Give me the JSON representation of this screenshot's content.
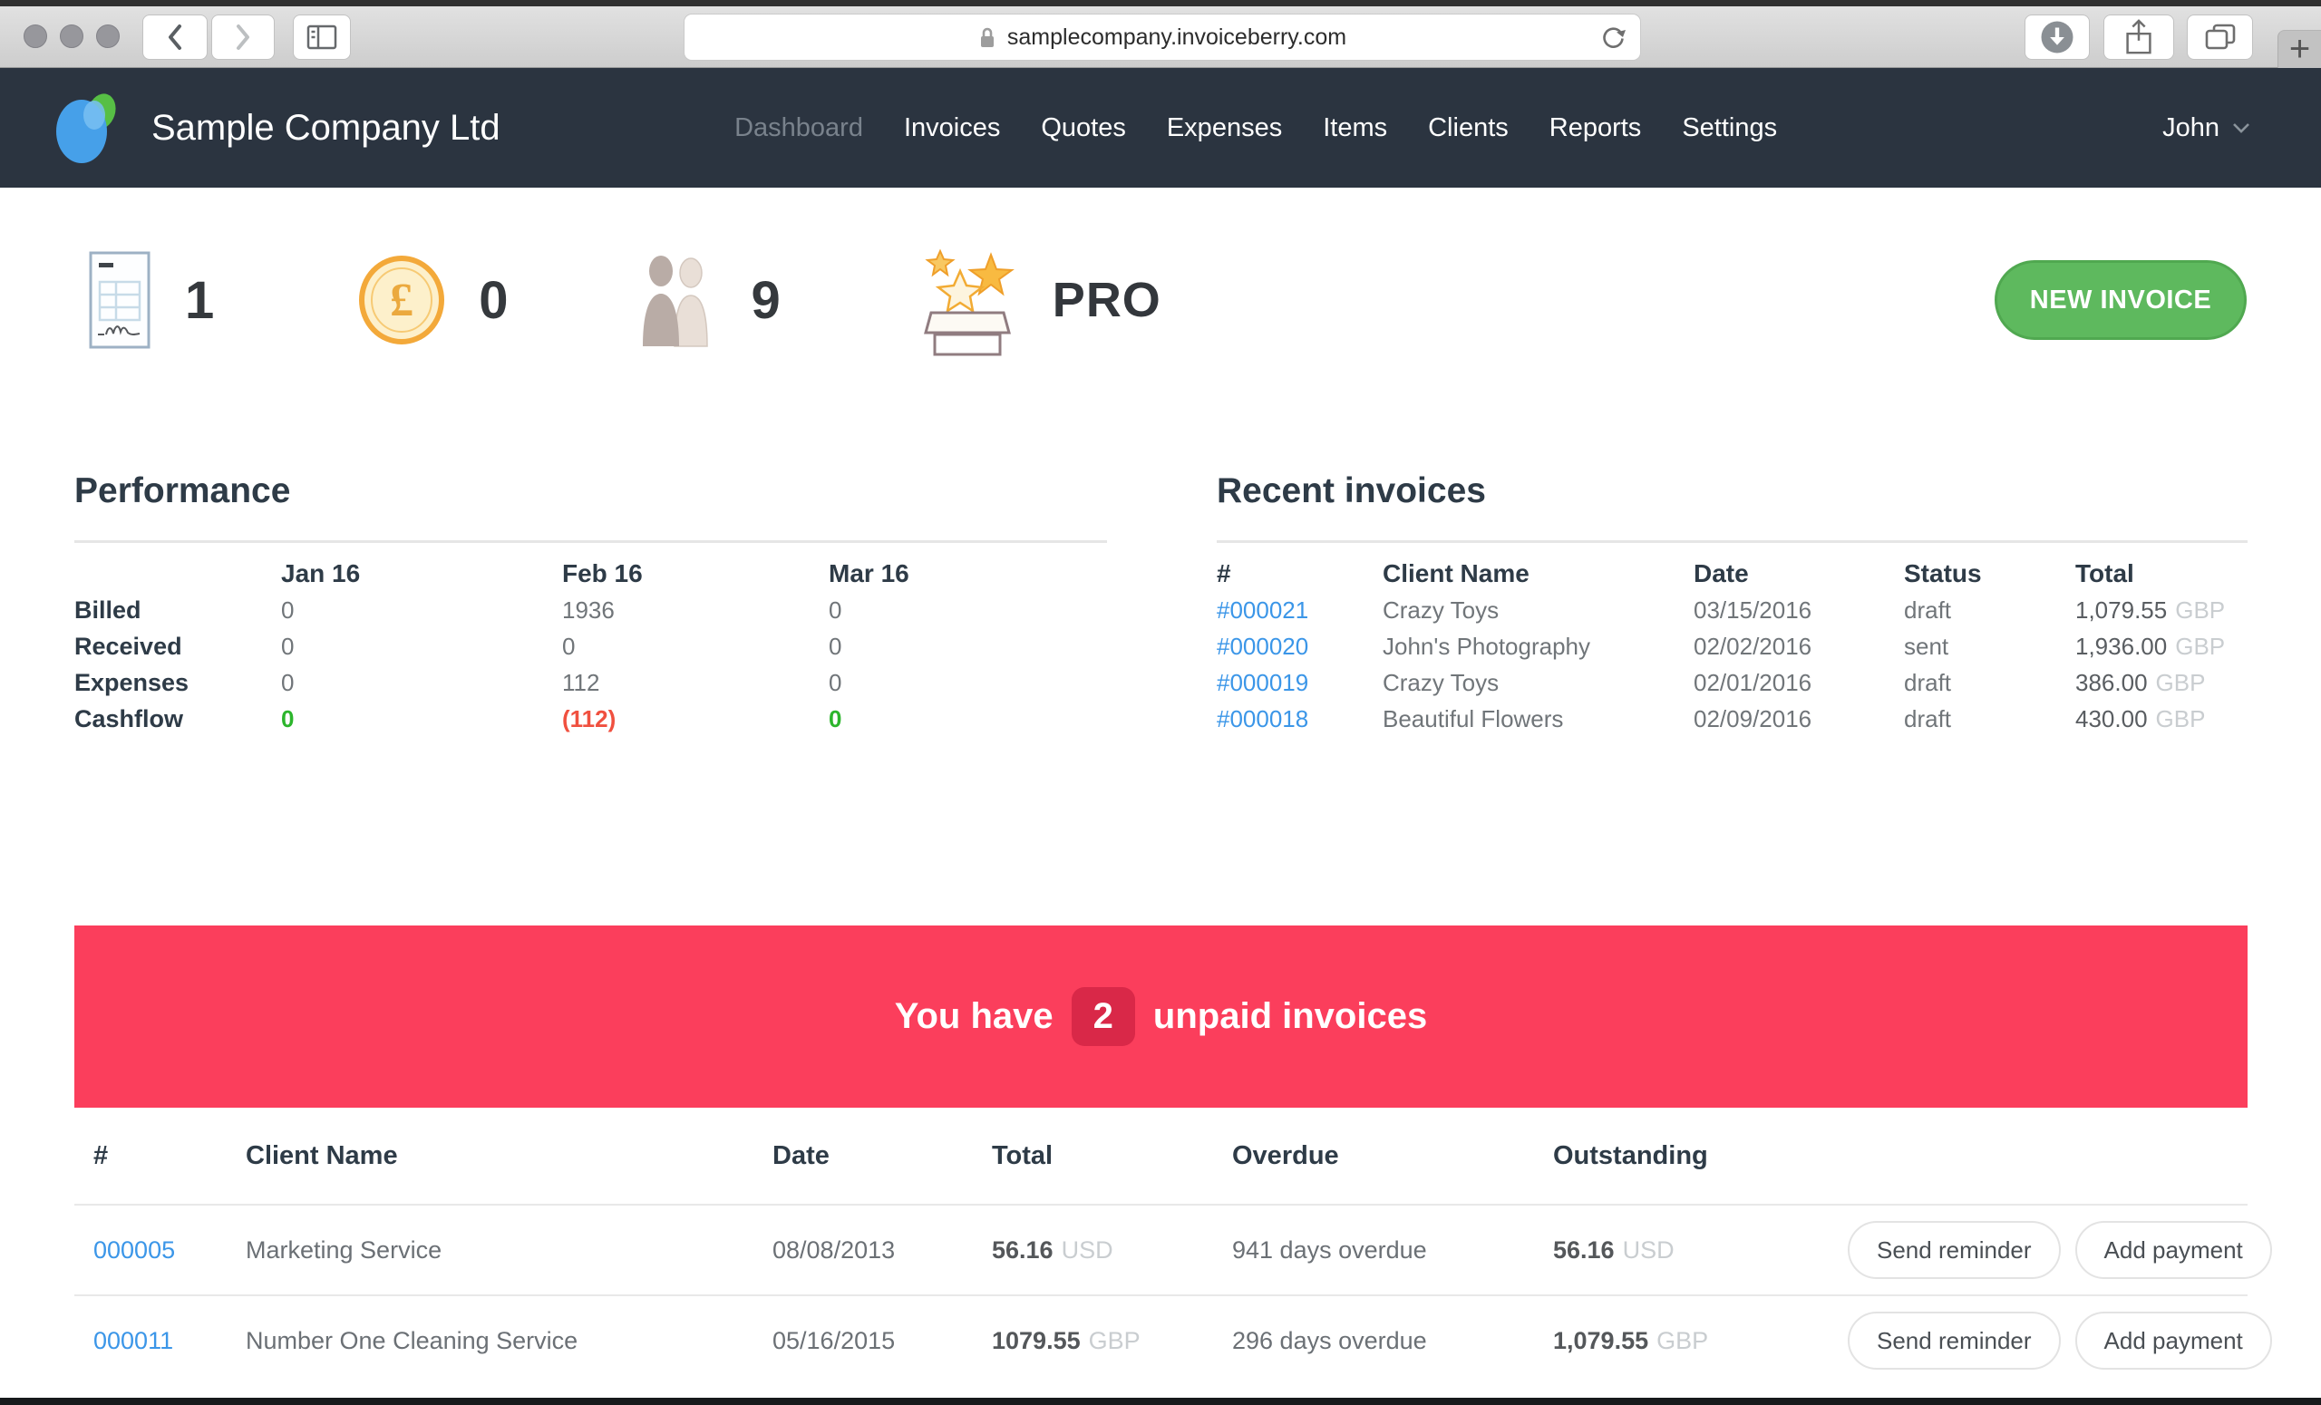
{
  "browser": {
    "url": "samplecompany.invoiceberry.com"
  },
  "nav": {
    "company": "Sample Company Ltd",
    "items": [
      {
        "label": "Dashboard",
        "current": true
      },
      {
        "label": "Invoices"
      },
      {
        "label": "Quotes"
      },
      {
        "label": "Expenses"
      },
      {
        "label": "Items"
      },
      {
        "label": "Clients"
      },
      {
        "label": "Reports"
      },
      {
        "label": "Settings"
      }
    ],
    "user": "John"
  },
  "stats": {
    "invoices": "1",
    "payments": "0",
    "clients": "9",
    "plan": "PRO"
  },
  "new_invoice_label": "NEW INVOICE",
  "performance": {
    "title": "Performance",
    "columns": [
      "Jan 16",
      "Feb 16",
      "Mar 16"
    ],
    "rows": [
      {
        "label": "Billed",
        "v1": "0",
        "v2": "1936",
        "v3": "0"
      },
      {
        "label": "Received",
        "v1": "0",
        "v2": "0",
        "v3": "0"
      },
      {
        "label": "Expenses",
        "v1": "0",
        "v2": "112",
        "v3": "0"
      },
      {
        "label": "Cashflow",
        "v1": "0",
        "v2": "(112)",
        "v3": "0"
      }
    ]
  },
  "recent": {
    "title": "Recent invoices",
    "headers": {
      "num": "#",
      "client": "Client Name",
      "date": "Date",
      "status": "Status",
      "total": "Total"
    },
    "rows": [
      {
        "num": "#000021",
        "client": "Crazy Toys",
        "date": "03/15/2016",
        "status": "draft",
        "total": "1,079.55",
        "cur": "GBP"
      },
      {
        "num": "#000020",
        "client": "John's Photography",
        "date": "02/02/2016",
        "status": "sent",
        "total": "1,936.00",
        "cur": "GBP"
      },
      {
        "num": "#000019",
        "client": "Crazy Toys",
        "date": "02/01/2016",
        "status": "draft",
        "total": "386.00",
        "cur": "GBP"
      },
      {
        "num": "#000018",
        "client": "Beautiful Flowers",
        "date": "02/09/2016",
        "status": "draft",
        "total": "430.00",
        "cur": "GBP"
      }
    ]
  },
  "banner": {
    "prefix": "You have",
    "count": "2",
    "suffix": "unpaid invoices"
  },
  "unpaid": {
    "headers": {
      "num": "#",
      "client": "Client Name",
      "date": "Date",
      "total": "Total",
      "overdue": "Overdue",
      "outstanding": "Outstanding"
    },
    "rows": [
      {
        "num": "000005",
        "client": "Marketing Service",
        "date": "08/08/2013",
        "total": "56.16",
        "total_cur": "USD",
        "overdue": "941 days overdue",
        "outstanding": "56.16",
        "outstanding_cur": "USD",
        "send": "Send reminder",
        "pay": "Add payment"
      },
      {
        "num": "000011",
        "client": "Number One Cleaning Service",
        "date": "05/16/2015",
        "total": "1079.55",
        "total_cur": "GBP",
        "overdue": "296 days overdue",
        "outstanding": "1,079.55",
        "outstanding_cur": "GBP",
        "send": "Send reminder",
        "pay": "Add payment"
      }
    ]
  },
  "colors": {
    "nav_dark": "#2b3440",
    "accent_green": "#5eb95e",
    "banner_red": "#fb3e5c",
    "badge_red": "#d92848",
    "link_blue": "#3b96e8",
    "positive_green": "#2cb52c",
    "negative_red": "#f0503f"
  }
}
